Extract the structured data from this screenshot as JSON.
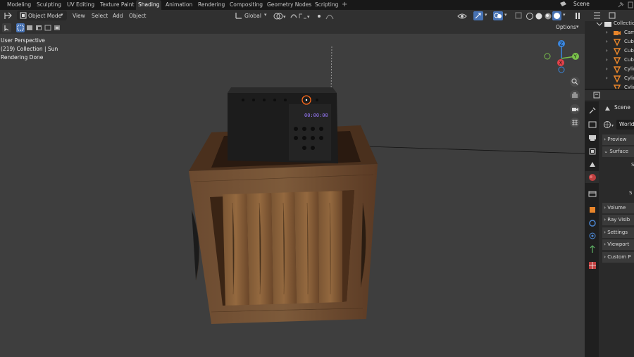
{
  "workspace_tabs": [
    "Modeling",
    "Sculpting",
    "UV Editing",
    "Texture Paint",
    "Shading",
    "Animation",
    "Rendering",
    "Compositing",
    "Geometry Nodes",
    "Scripting"
  ],
  "active_workspace": "Shading",
  "scene_name": "Scene",
  "header": {
    "mode": "Object Mode",
    "menus": [
      "View",
      "Select",
      "Add",
      "Object"
    ],
    "transform_orientation": "Global"
  },
  "tool_header": {
    "options_label": "Options"
  },
  "viewport": {
    "perspective": "User Perspective",
    "collection_info": "(219) Collection | Sun",
    "status": "Rendering Done",
    "clock_display": "00:00:00"
  },
  "outliner": {
    "root": "Collection",
    "items": [
      {
        "label": "Cam",
        "icon": "camera-icon"
      },
      {
        "label": "Cub",
        "icon": "mesh-icon"
      },
      {
        "label": "Cub",
        "icon": "mesh-icon"
      },
      {
        "label": "Cub",
        "icon": "mesh-icon"
      },
      {
        "label": "Cylin",
        "icon": "mesh-icon"
      },
      {
        "label": "Cylin",
        "icon": "mesh-icon"
      },
      {
        "label": "Cylin",
        "icon": "mesh-icon"
      }
    ]
  },
  "properties": {
    "scene_label": "Scene",
    "world_label": "World",
    "panels": [
      "Preview",
      "Surface",
      "Volume",
      "Ray Visib",
      "Settings",
      "Viewport",
      "Custom P"
    ],
    "partial_labels": [
      "S",
      "S"
    ]
  },
  "colors": {
    "accent_blue": "#4772b3",
    "active_tab_bg": "#303030",
    "viewport_bg": "#3e3e3e",
    "axis_x": "#e4424a",
    "axis_y": "#7ac14b",
    "axis_z": "#3a87e0",
    "mesh_orange": "#e8852a"
  }
}
